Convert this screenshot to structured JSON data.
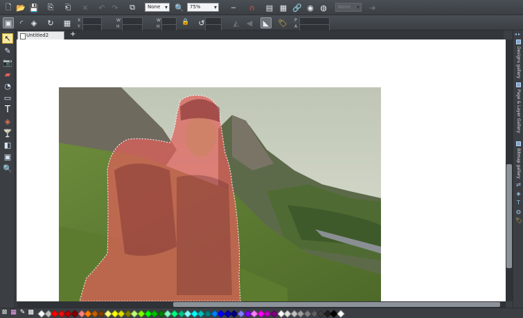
{
  "toolbar": {
    "quality_select": "None",
    "zoom_select": "75%",
    "disabled_field_value": "None"
  },
  "infobar": {
    "labels": {
      "x": "X",
      "y": "Y",
      "w": "W",
      "h": "H",
      "w2": "W",
      "h2": "H",
      "p": "P",
      "a": "A"
    }
  },
  "document": {
    "tab_title": "Untitled2",
    "add_tab": "+"
  },
  "right_panel": {
    "designs_gallery": "Designs gallery",
    "page_layer_gallery": "Page & Layer Gallery",
    "bitmap_gallery": "Bitmap gallery",
    "nav_arrows": "◂ ▸",
    "close": "×"
  },
  "icons": {
    "new": "new-document-icon",
    "open": "open-icon",
    "save": "save-icon",
    "import": "import-icon",
    "export": "export-icon",
    "delete": "delete-icon",
    "undo": "undo-icon",
    "redo": "redo-icon",
    "zoom": "zoom-icon",
    "snap": "snap-magnet-icon",
    "link": "link-icon"
  },
  "colors": {
    "accent": "#f6e9a3",
    "chrome": "#3b3f44",
    "canvas": "#ffffff",
    "selection_overlay": "#e0605a"
  },
  "palette": [
    "#ffffff",
    "#c0c0c0",
    "#ff0000",
    "#e81010",
    "#c00000",
    "#800000",
    "#ff8080",
    "#ff8000",
    "#c06000",
    "#804000",
    "#ffff80",
    "#ffff00",
    "#e0e000",
    "#808000",
    "#c0ff80",
    "#80ff00",
    "#00ff00",
    "#00c000",
    "#008000",
    "#80ffc0",
    "#00ff80",
    "#00c080",
    "#80ffff",
    "#00ffff",
    "#00c0c0",
    "#008080",
    "#0080ff",
    "#0000ff",
    "#0000c0",
    "#000080",
    "#8080ff",
    "#8000ff",
    "#ff80ff",
    "#ff00ff",
    "#c000c0",
    "#800080",
    "#ffffff",
    "#e0e0e0",
    "#c0c0c0",
    "#a0a0a0",
    "#808080",
    "#606060",
    "#404040",
    "#202020",
    "#000000",
    "#ffffff"
  ]
}
